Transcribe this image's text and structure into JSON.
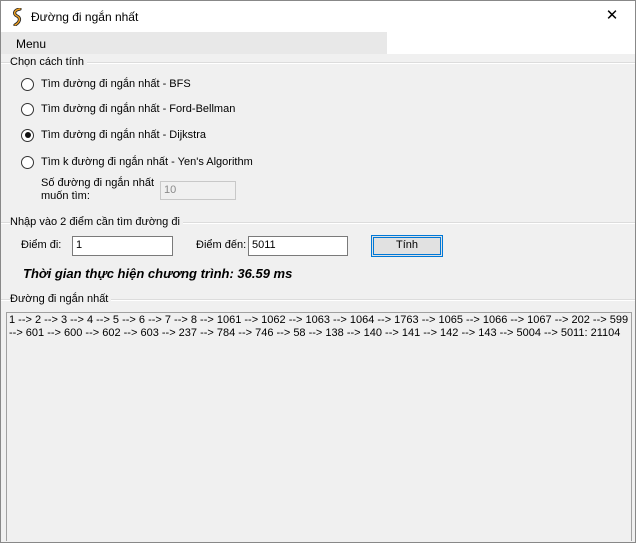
{
  "window": {
    "title": "Đường đi ngắn nhất",
    "close_glyph": "✕"
  },
  "menu": {
    "label": "Menu"
  },
  "method_group": {
    "title": "Chọn cách tính",
    "options": [
      {
        "label": "Tìm đường đi ngắn nhất - BFS",
        "checked": false
      },
      {
        "label": "Tìm đường đi ngắn nhất - Ford-Bellman",
        "checked": false
      },
      {
        "label": "Tìm đường đi ngắn nhất - Dijkstra",
        "checked": true
      },
      {
        "label": "Tìm k đường đi ngắn nhất - Yen's Algorithm",
        "checked": false
      }
    ],
    "k_label_line1": "Số đường đi ngắn nhất",
    "k_label_line2": "muốn tìm:",
    "k_value": "10"
  },
  "points_group": {
    "title": "Nhập vào 2 điểm cần tìm đường đi",
    "from_label": "Điểm đi:",
    "from_value": "1",
    "to_label": "Điểm đến:",
    "to_value": "5011",
    "compute_label": "Tính"
  },
  "execution_time": "Thời gian thực hiện chương trình: 36.59 ms",
  "result_group": {
    "title": "Đường đi ngắn nhất",
    "path_text": "1 --> 2 --> 3 --> 4 --> 5 --> 6 --> 7 --> 8 --> 1061 --> 1062 --> 1063 --> 1064 --> 1763 --> 1065 --> 1066 --> 1067 --> 202 --> 599 --> 601 --> 600 --> 602 --> 603 --> 237 --> 784 --> 746 --> 58 --> 138 --> 140 --> 141 --> 142 --> 143 --> 5004 --> 5011: 21104"
  },
  "colors": {
    "accent": "#0078d7",
    "background": "#f0f0f0",
    "titlebar": "#ffffff",
    "menubar": "#e8e8e8"
  }
}
